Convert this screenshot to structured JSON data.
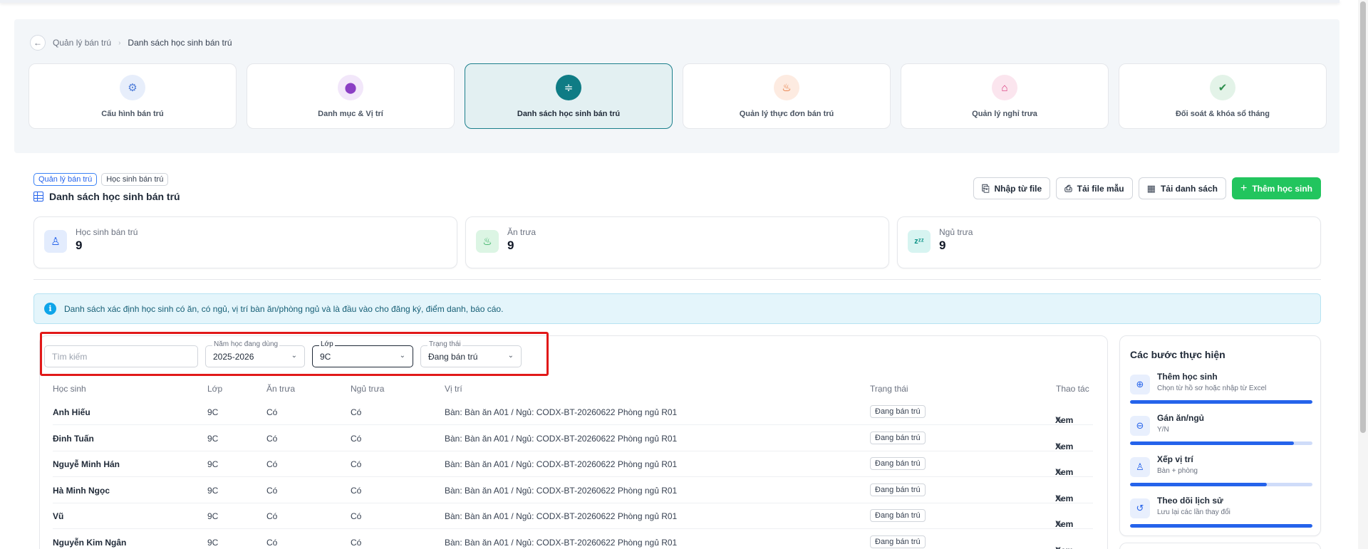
{
  "breadcrumb": {
    "parent": "Quản lý bán trú",
    "current": "Danh sách học sinh bán trú"
  },
  "modules": [
    {
      "label": "Cấu hình bán trú",
      "icon": "gear-icon",
      "color": "#4f7dd9",
      "bg": "#e7eefb",
      "glyph": "⚙"
    },
    {
      "label": "Danh mục & Vị trí",
      "icon": "map-pin-icon",
      "color": "#8b3fc4",
      "bg": "#f2e7fa",
      "glyph": "⬤"
    },
    {
      "label": "Danh sách học sinh bán trú",
      "icon": "students-icon",
      "color": "#ffffff",
      "bg": "#0f7c85",
      "glyph": "≑",
      "active": true
    },
    {
      "label": "Quản lý thực đơn bán trú",
      "icon": "chef-hat-icon",
      "color": "#e2601c",
      "bg": "#fdebe1",
      "glyph": "♨"
    },
    {
      "label": "Quản lý nghỉ trưa",
      "icon": "bed-icon",
      "color": "#d8367a",
      "bg": "#fbe5ee",
      "glyph": "⌂"
    },
    {
      "label": "Đối soát & khóa sổ tháng",
      "icon": "check-badge-icon",
      "color": "#2f8f4e",
      "bg": "#e3f3e8",
      "glyph": "✔"
    }
  ],
  "tags": [
    "Quản lý bán trú",
    "Học sinh bán trú"
  ],
  "page_title": "Danh sách học sinh bán trú",
  "actions": {
    "import": "Nhập từ file",
    "template": "Tải file mẫu",
    "download": "Tải danh sách",
    "add": "Thêm học sinh"
  },
  "stats": [
    {
      "label": "Học sinh bán trú",
      "value": "9",
      "icon": "student-icon",
      "color": "#2563eb",
      "bg": "#e3ecfd",
      "glyph": "♙"
    },
    {
      "label": "Ăn trưa",
      "value": "9",
      "icon": "lunch-icon",
      "color": "#16a34a",
      "bg": "#dcf5e4",
      "glyph": "♨"
    },
    {
      "label": "Ngủ trưa",
      "value": "9",
      "icon": "sleep-icon",
      "color": "#0d9488",
      "bg": "#d7f4f1",
      "glyph": "zᶻᶻ"
    }
  ],
  "info": "Danh sách xác định học sinh có ăn, có ngủ, vị trí bàn ăn/phòng ngủ và là đầu vào cho đăng ký, điểm danh, báo cáo.",
  "filters": {
    "search_placeholder": "Tìm kiếm",
    "year_label": "Năm học đang dùng",
    "year_value": "2025-2026",
    "class_label": "Lớp",
    "class_value": "9C",
    "status_label": "Trạng thái",
    "status_value": "Đang bán trú"
  },
  "table": {
    "headers": [
      "Học sinh",
      "Lớp",
      "Ăn trưa",
      "Ngủ trưa",
      "Vị trí",
      "Trạng thái",
      "Thao tác"
    ],
    "rows": [
      {
        "name": "Anh Hiếu",
        "class": "9C",
        "lunch": "Có",
        "nap": "Có",
        "location": "Bàn: Bàn ăn A01 / Ngủ: CODX-BT-20260622 Phòng ngủ R01",
        "status": "Đang bán trú",
        "action": "Xem"
      },
      {
        "name": "Đinh Tuấn",
        "class": "9C",
        "lunch": "Có",
        "nap": "Có",
        "location": "Bàn: Bàn ăn A01 / Ngủ: CODX-BT-20260622 Phòng ngủ R01",
        "status": "Đang bán trú",
        "action": "Xem"
      },
      {
        "name": "Nguyễ Minh Hán",
        "class": "9C",
        "lunch": "Có",
        "nap": "Có",
        "location": "Bàn: Bàn ăn A01 / Ngủ: CODX-BT-20260622 Phòng ngủ R01",
        "status": "Đang bán trú",
        "action": "Xem"
      },
      {
        "name": "Hà Minh Ngọc",
        "class": "9C",
        "lunch": "Có",
        "nap": "Có",
        "location": "Bàn: Bàn ăn A01 / Ngủ: CODX-BT-20260622 Phòng ngủ R01",
        "status": "Đang bán trú",
        "action": "Xem"
      },
      {
        "name": "Vũ",
        "class": "9C",
        "lunch": "Có",
        "nap": "Có",
        "location": "Bàn: Bàn ăn A01 / Ngủ: CODX-BT-20260622 Phòng ngủ R01",
        "status": "Đang bán trú",
        "action": "Xem"
      },
      {
        "name": "Nguyễn Kim Ngân",
        "class": "9C",
        "lunch": "Có",
        "nap": "Có",
        "location": "Bàn: Bàn ăn A01 / Ngủ: CODX-BT-20260622 Phòng ngủ R01",
        "status": "Đang bán trú",
        "action": "Xem"
      }
    ]
  },
  "steps": {
    "title": "Các bước thực hiện",
    "items": [
      {
        "title": "Thêm học sinh",
        "desc": "Chọn từ hồ sơ hoặc nhập từ Excel",
        "icon": "user-plus-icon",
        "glyph": "⊕",
        "progress": 1.0
      },
      {
        "title": "Gán ăn/ngủ",
        "desc": "Y/N",
        "icon": "toggle-icon",
        "glyph": "⊖",
        "progress": 0.9
      },
      {
        "title": "Xếp vị trí",
        "desc": "Bàn + phòng",
        "icon": "seat-icon",
        "glyph": "♙",
        "progress": 0.75
      },
      {
        "title": "Theo dõi lịch sử",
        "desc": "Lưu lại các lần thay đổi",
        "icon": "history-icon",
        "glyph": "↺",
        "progress": 1.0
      }
    ]
  },
  "colors": {
    "accent": "#1b7f8c",
    "primary": "#2563eb",
    "success": "#22c55e",
    "highlight": "#e11919"
  }
}
